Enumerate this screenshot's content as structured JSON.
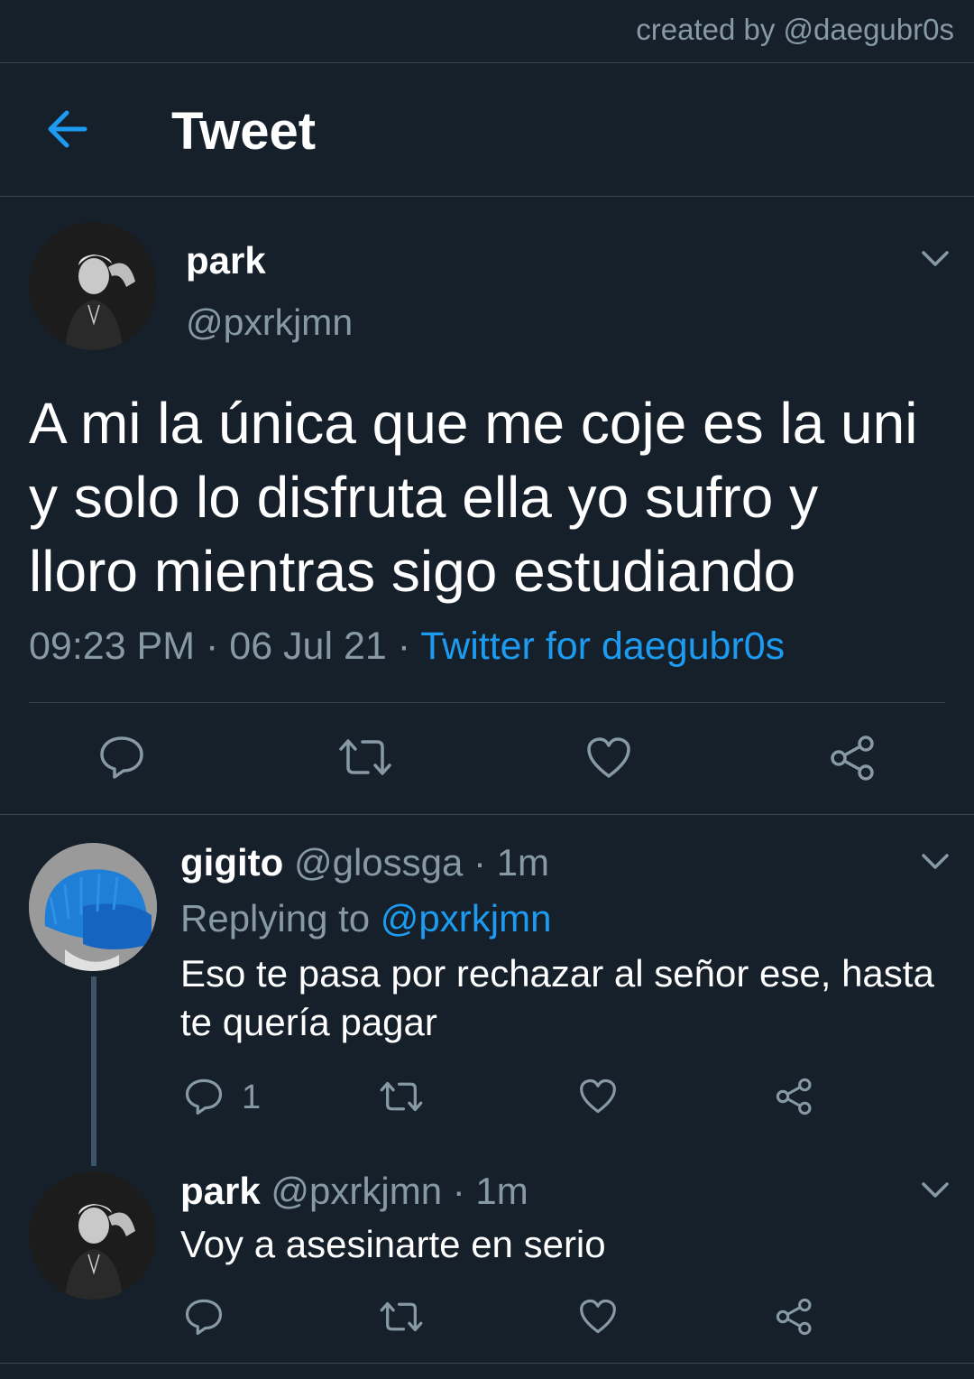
{
  "credit": "created by @daegubr0s",
  "header": {
    "title": "Tweet"
  },
  "tweet": {
    "name": "park",
    "handle": "@pxrkjmn",
    "text": "A mi la única que me coje es la uni y solo lo disfruta ella yo sufro y lloro mientras sigo estudiando",
    "time": "09:23 PM",
    "sep1": " · ",
    "date": "06 Jul 21",
    "sep2": " · ",
    "source": "Twitter for daegubr0s"
  },
  "replies": [
    {
      "name": "gigito",
      "handle": "@glossga",
      "sep": " · ",
      "time": "1m",
      "replying_label": "Replying to ",
      "replying_to": "@pxrkjmn",
      "text": "Eso te pasa por rechazar al señor ese, hasta te quería pagar",
      "reply_count": "1"
    },
    {
      "name": "park",
      "handle": "@pxrkjmn",
      "sep": " · ",
      "time": "1m",
      "text": "Voy a asesinarte en serio"
    }
  ],
  "colors": {
    "background": "#15202b",
    "accent": "#1d9bf0",
    "muted": "#8899a6",
    "divider": "#38444d"
  },
  "icons": [
    "back-arrow-icon",
    "chevron-down-icon",
    "reply-icon",
    "retweet-icon",
    "like-icon",
    "share-icon"
  ]
}
